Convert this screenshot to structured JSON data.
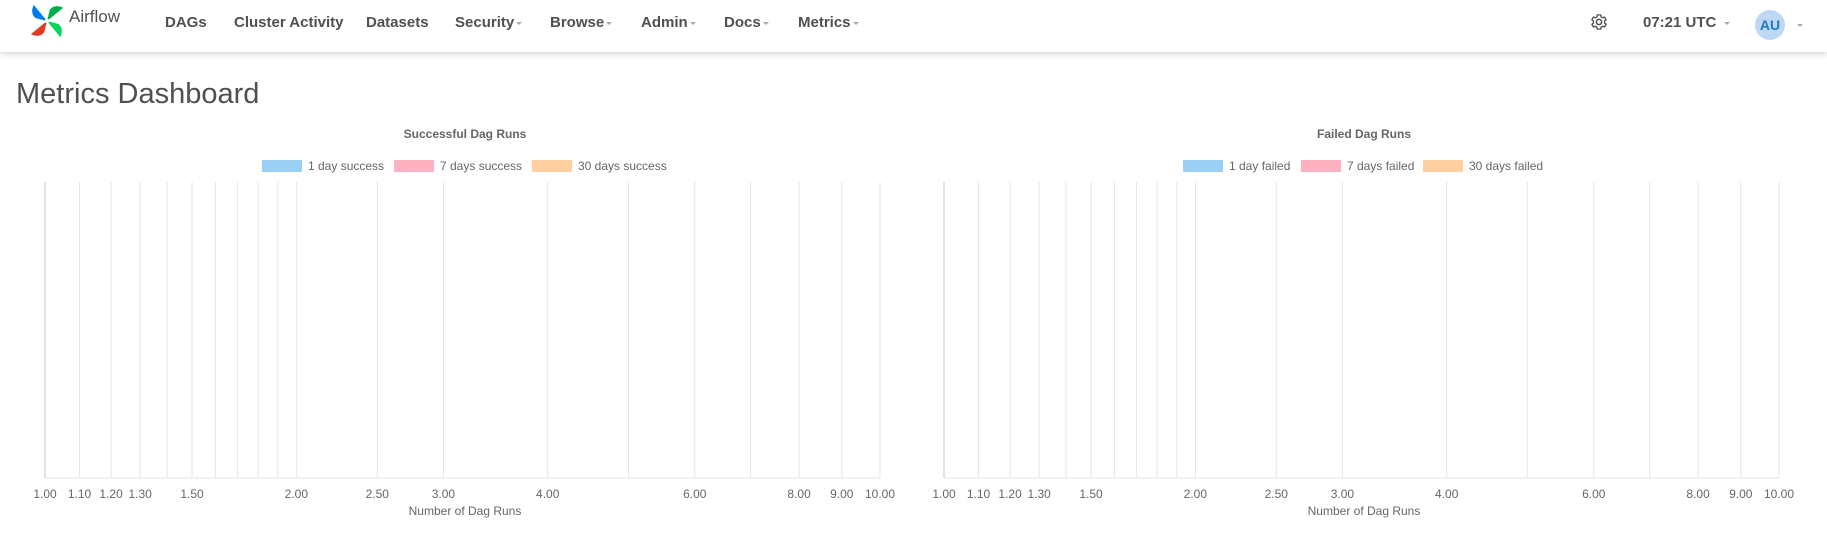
{
  "navbar": {
    "brand": "Airflow",
    "items": [
      {
        "label": "DAGs",
        "dropdown": false
      },
      {
        "label": "Cluster Activity",
        "dropdown": false
      },
      {
        "label": "Datasets",
        "dropdown": false
      },
      {
        "label": "Security",
        "dropdown": true
      },
      {
        "label": "Browse",
        "dropdown": true
      },
      {
        "label": "Admin",
        "dropdown": true
      },
      {
        "label": "Docs",
        "dropdown": true
      },
      {
        "label": "Metrics",
        "dropdown": true
      }
    ],
    "time": "07:21 UTC",
    "user_initials": "AU"
  },
  "page": {
    "title": "Metrics Dashboard"
  },
  "colors": {
    "series_1": "#9ad0f5",
    "series_2": "#ffb1c1",
    "series_3": "#ffcf9f",
    "grid": "#e5e5e5",
    "text": "#666666"
  },
  "chart_data": [
    {
      "type": "bar",
      "title": "Successful Dag Runs",
      "xlabel": "Number of Dag Runs",
      "ylabel": "",
      "x_scale": "log",
      "xlim": [
        1,
        10
      ],
      "grid": true,
      "legend_position": "top",
      "x_tick_labels": [
        "1.00",
        "1.10",
        "1.20",
        "1.30",
        "1.50",
        "2.00",
        "2.50",
        "3.00",
        "4.00",
        "6.00",
        "8.00",
        "9.00",
        "10.00"
      ],
      "series": [
        {
          "name": "1 day success",
          "values": []
        },
        {
          "name": "7 days success",
          "values": []
        },
        {
          "name": "30 days success",
          "values": []
        }
      ]
    },
    {
      "type": "bar",
      "title": "Failed Dag Runs",
      "xlabel": "Number of Dag Runs",
      "ylabel": "",
      "x_scale": "log",
      "xlim": [
        1,
        10
      ],
      "grid": true,
      "legend_position": "top",
      "x_tick_labels": [
        "1.00",
        "1.10",
        "1.20",
        "1.30",
        "1.50",
        "2.00",
        "2.50",
        "3.00",
        "4.00",
        "6.00",
        "8.00",
        "9.00",
        "10.00"
      ],
      "series": [
        {
          "name": "1 day failed",
          "values": []
        },
        {
          "name": "7 days failed",
          "values": []
        },
        {
          "name": "30 days failed",
          "values": []
        }
      ]
    }
  ]
}
